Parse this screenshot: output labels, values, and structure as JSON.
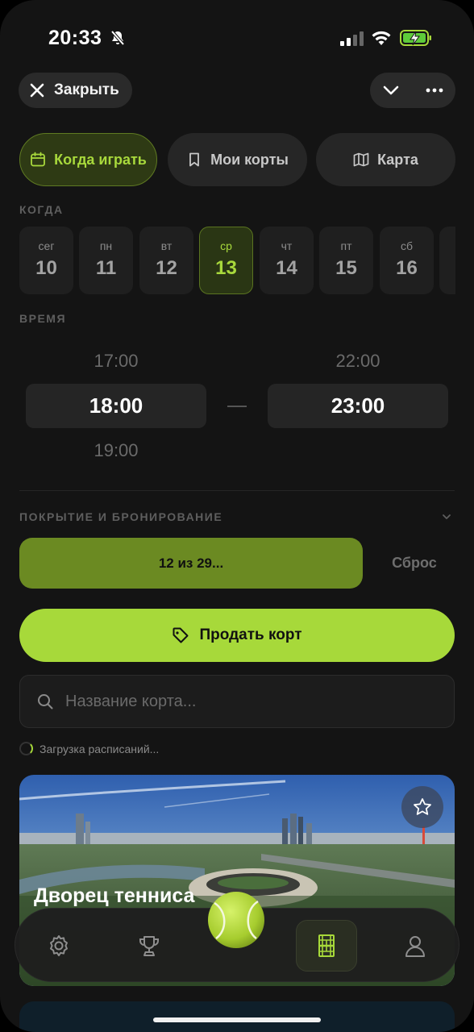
{
  "status_bar": {
    "time": "20:33"
  },
  "header": {
    "close_label": "Закрыть"
  },
  "tabs": [
    {
      "label": "Когда играть",
      "icon": "calendar-icon",
      "active": true
    },
    {
      "label": "Мои корты",
      "icon": "bookmark-icon",
      "active": false
    },
    {
      "label": "Карта",
      "icon": "map-icon",
      "active": false
    }
  ],
  "when": {
    "label": "КОГДА",
    "days": [
      {
        "name": "сег",
        "num": "10"
      },
      {
        "name": "пн",
        "num": "11"
      },
      {
        "name": "вт",
        "num": "12"
      },
      {
        "name": "ср",
        "num": "13",
        "active": true
      },
      {
        "name": "чт",
        "num": "14"
      },
      {
        "name": "пт",
        "num": "15"
      },
      {
        "name": "сб",
        "num": "16"
      }
    ]
  },
  "time_range": {
    "label": "ВРЕМЯ",
    "start": {
      "prev": "17:00",
      "value": "18:00",
      "next": "19:00"
    },
    "end": {
      "prev": "22:00",
      "value": "23:00"
    }
  },
  "coverage": {
    "label": "ПОКРЫТИЕ И БРОНИРОВАНИЕ",
    "filter_label": "12 из 29...",
    "reset_label": "Сброс"
  },
  "sell_button": {
    "label": "Продать корт",
    "icon": "tag-icon"
  },
  "search": {
    "placeholder": "Название корта...",
    "value": ""
  },
  "loading_text": "Загрузка расписаний...",
  "court_card": {
    "title": "Дворец тенниса"
  },
  "bottom_nav": [
    {
      "icon": "gear-icon"
    },
    {
      "icon": "trophy-icon"
    },
    {
      "icon": "tennis-ball-icon"
    },
    {
      "icon": "court-icon",
      "active": true
    },
    {
      "icon": "user-icon"
    }
  ],
  "colors": {
    "accent": "#a7d93a",
    "background": "#141414"
  }
}
